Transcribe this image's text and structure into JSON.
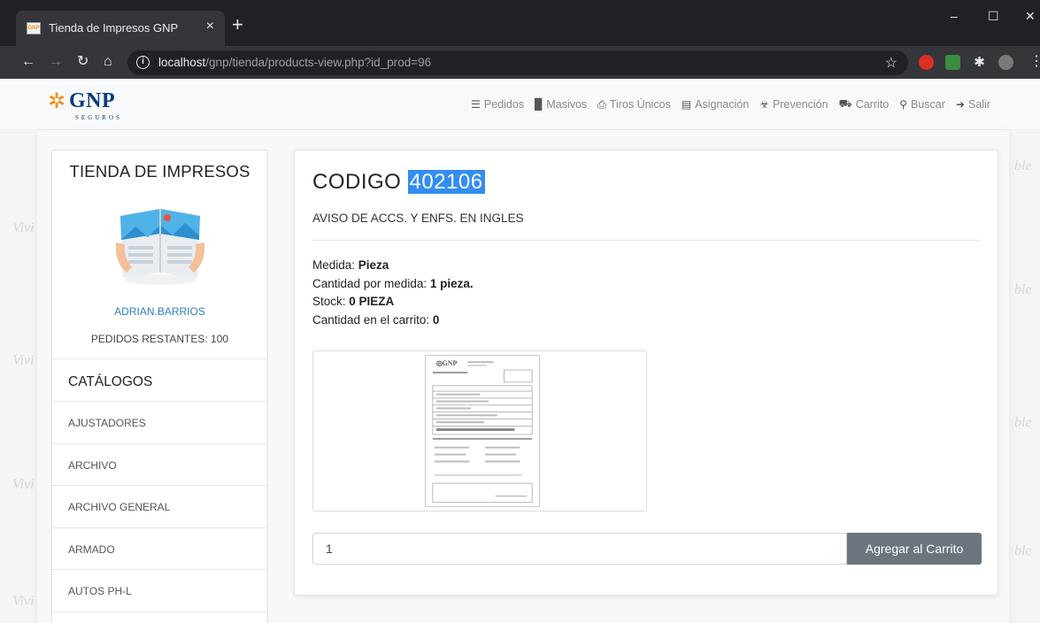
{
  "browser": {
    "tab_title": "Tienda de Impresos GNP",
    "tab_favicon": "GNP",
    "url_host": "localhost",
    "url_path": "/gnp/tienda/products-view.php?id_prod=96"
  },
  "navbar": {
    "logo_text": "GNP",
    "logo_sub": "SEGUROS",
    "items": [
      {
        "label": "Pedidos",
        "icon": "list-icon"
      },
      {
        "label": "Masivos",
        "icon": "stack-icon"
      },
      {
        "label": "Tiros Únicos",
        "icon": "print-icon"
      },
      {
        "label": "Asignación",
        "icon": "clipboard-icon"
      },
      {
        "label": "Prevención",
        "icon": "biohazard-icon"
      },
      {
        "label": "Carrito",
        "icon": "cart-icon"
      },
      {
        "label": "Buscar",
        "icon": "search-icon"
      },
      {
        "label": "Salir",
        "icon": "sign-out-icon"
      }
    ]
  },
  "sidebar": {
    "title": "TIENDA DE IMPRESOS",
    "username": "ADRIAN.BARRIOS",
    "remaining": "PEDIDOS RESTANTES: 100",
    "catalog_header": "CATÁLOGOS",
    "categories": [
      "AJUSTADORES",
      "ARCHIVO",
      "ARCHIVO GENERAL",
      "ARMADO",
      "AUTOS PH-L"
    ]
  },
  "product": {
    "code_label": "CODIGO",
    "code_value": "402106",
    "name": "AVISO DE ACCS. Y ENFS. EN INGLES",
    "measure_label": "Medida: ",
    "measure_value": "Pieza",
    "qty_per_label": "Cantidad por medida: ",
    "qty_per_value": "1 pieza.",
    "stock_label": "Stock: ",
    "stock_value": "0 PIEZA",
    "cart_qty_label": "Cantidad en el carrito: ",
    "cart_qty_value": "0",
    "qty_input_value": "1",
    "add_button": "Agregar al Carrito"
  },
  "colors": {
    "accent_blue": "#338df2",
    "button_gray": "#6c757d",
    "user_blue": "#2d7fc4",
    "brand_orange": "#f48d1f",
    "brand_navy": "#063c7a"
  }
}
